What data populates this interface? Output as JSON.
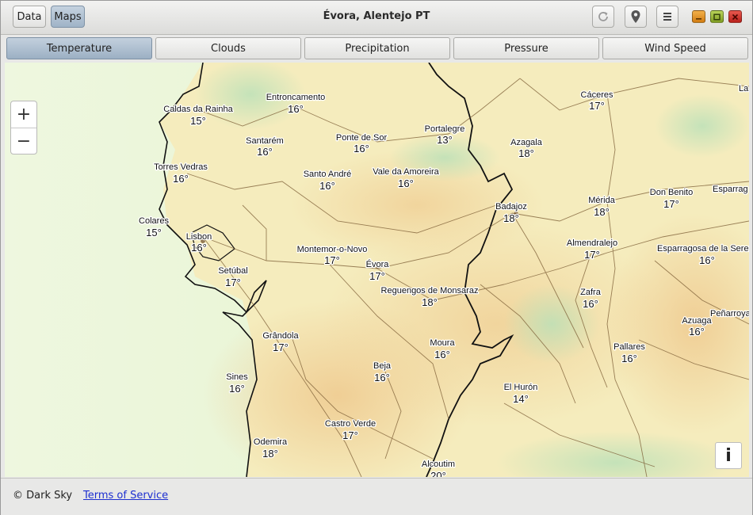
{
  "titlebar": {
    "left_buttons": [
      {
        "label": "Data"
      },
      {
        "label": "Maps"
      }
    ],
    "title": "Évora, Alentejo PT",
    "icons": [
      "refresh-icon",
      "location-pin-icon",
      "menu-icon"
    ],
    "window_controls": [
      "minimize",
      "maximize",
      "close"
    ]
  },
  "tabs": [
    {
      "label": "Temperature",
      "active": true
    },
    {
      "label": "Clouds"
    },
    {
      "label": "Precipitation"
    },
    {
      "label": "Pressure"
    },
    {
      "label": "Wind Speed"
    }
  ],
  "map": {
    "zoom_in": "+",
    "zoom_out": "−",
    "info": "i",
    "cities": [
      {
        "name": "Caldas da Rainha",
        "temp": "15°"
      },
      {
        "name": "Entroncamento",
        "temp": "16°"
      },
      {
        "name": "Santarém",
        "temp": "16°"
      },
      {
        "name": "Ponte de Sor",
        "temp": "16°"
      },
      {
        "name": "Portalegre",
        "temp": "13°"
      },
      {
        "name": "Cáceres",
        "temp": "17°"
      },
      {
        "name": "Azagala",
        "temp": "18°"
      },
      {
        "name": "Torres Vedras",
        "temp": "16°"
      },
      {
        "name": "Santo André",
        "temp": "16°"
      },
      {
        "name": "Vale da Amoreira",
        "temp": "16°"
      },
      {
        "name": "Badajoz",
        "temp": "18°"
      },
      {
        "name": "Mérida",
        "temp": "18°"
      },
      {
        "name": "Don Benito",
        "temp": "17°"
      },
      {
        "name": "Esparrag",
        "temp": ""
      },
      {
        "name": "La",
        "temp": ""
      },
      {
        "name": "Colares",
        "temp": "15°"
      },
      {
        "name": "Lisbon",
        "temp": "16°"
      },
      {
        "name": "Montemor-o-Novo",
        "temp": "17°"
      },
      {
        "name": "Évora",
        "temp": "17°"
      },
      {
        "name": "Almendralejo",
        "temp": "17°"
      },
      {
        "name": "Esparragosa de la Seren",
        "temp": "16°"
      },
      {
        "name": "Setúbal",
        "temp": "17°"
      },
      {
        "name": "Reguengos de Monsaraz",
        "temp": "18°"
      },
      {
        "name": "Zafra",
        "temp": "16°"
      },
      {
        "name": "Azuaga",
        "temp": "16°"
      },
      {
        "name": "Peñarroya",
        "temp": ""
      },
      {
        "name": "Grândola",
        "temp": "17°"
      },
      {
        "name": "Moura",
        "temp": "16°"
      },
      {
        "name": "Pallares",
        "temp": "16°"
      },
      {
        "name": "Sines",
        "temp": "16°"
      },
      {
        "name": "Beja",
        "temp": "16°"
      },
      {
        "name": "El Hurón",
        "temp": "14°"
      },
      {
        "name": "Castro Verde",
        "temp": "17°"
      },
      {
        "name": "Odemira",
        "temp": "18°"
      },
      {
        "name": "Alcoutim",
        "temp": "20°"
      }
    ]
  },
  "footer": {
    "copyright": "© Dark Sky",
    "terms": "Terms of Service"
  }
}
